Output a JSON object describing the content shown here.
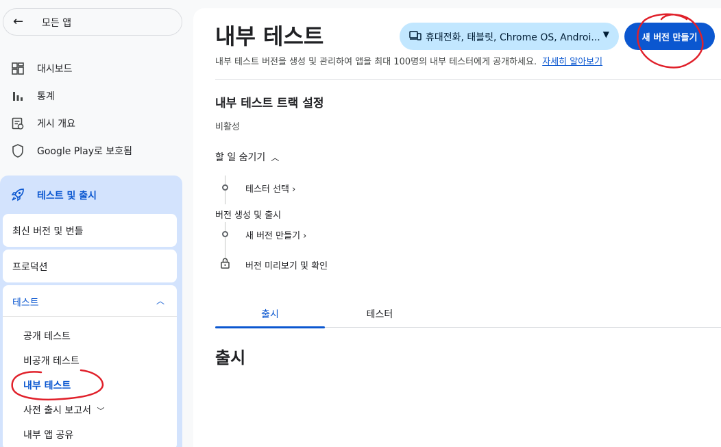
{
  "sidebar": {
    "back_label": "모든 앱",
    "top_items": [
      {
        "label": "대시보드",
        "icon": "dashboard-icon"
      },
      {
        "label": "통계",
        "icon": "bar-chart-icon"
      },
      {
        "label": "게시 개요",
        "icon": "publishing-overview-icon"
      },
      {
        "label": "Google Play로 보호됨",
        "icon": "shield-icon"
      }
    ],
    "section_label": "테스트 및 출시",
    "cards": {
      "latest": "최신 버전 및 번들",
      "production": "프로덕션",
      "testing": "테스트"
    },
    "testing_items": [
      "공개 테스트",
      "비공개 테스트",
      "내부 테스트",
      "사전 출시 보고서",
      "내부 앱 공유"
    ]
  },
  "main": {
    "title": "내부 테스트",
    "device_selector": "휴대전화, 태블릿, Chrome OS, Androi...",
    "create_button": "새 버전 만들기",
    "description": "내부 테스트 버전을 생성 및 관리하여 앱을 최대 100명의 내부 테스터에게 공개하세요.",
    "learn_more": "자세히 알아보기",
    "track_heading": "내부 테스트 트랙 설정",
    "status": "비활성",
    "hide_todo": "할 일 숨기기",
    "steps": {
      "select_testers": "테스터 선택 ›",
      "group_label": "버전 생성 및 출시",
      "create_release": "새 버전 만들기 ›",
      "preview_release": "버전 미리보기 및 확인"
    },
    "tabs": [
      "출시",
      "테스터"
    ],
    "section_title": "출시"
  },
  "colors": {
    "accent": "#0b57d0",
    "section_bg": "#d3e3fd",
    "device_chip_bg": "#c2e7ff",
    "annotation": "#e0202a"
  }
}
